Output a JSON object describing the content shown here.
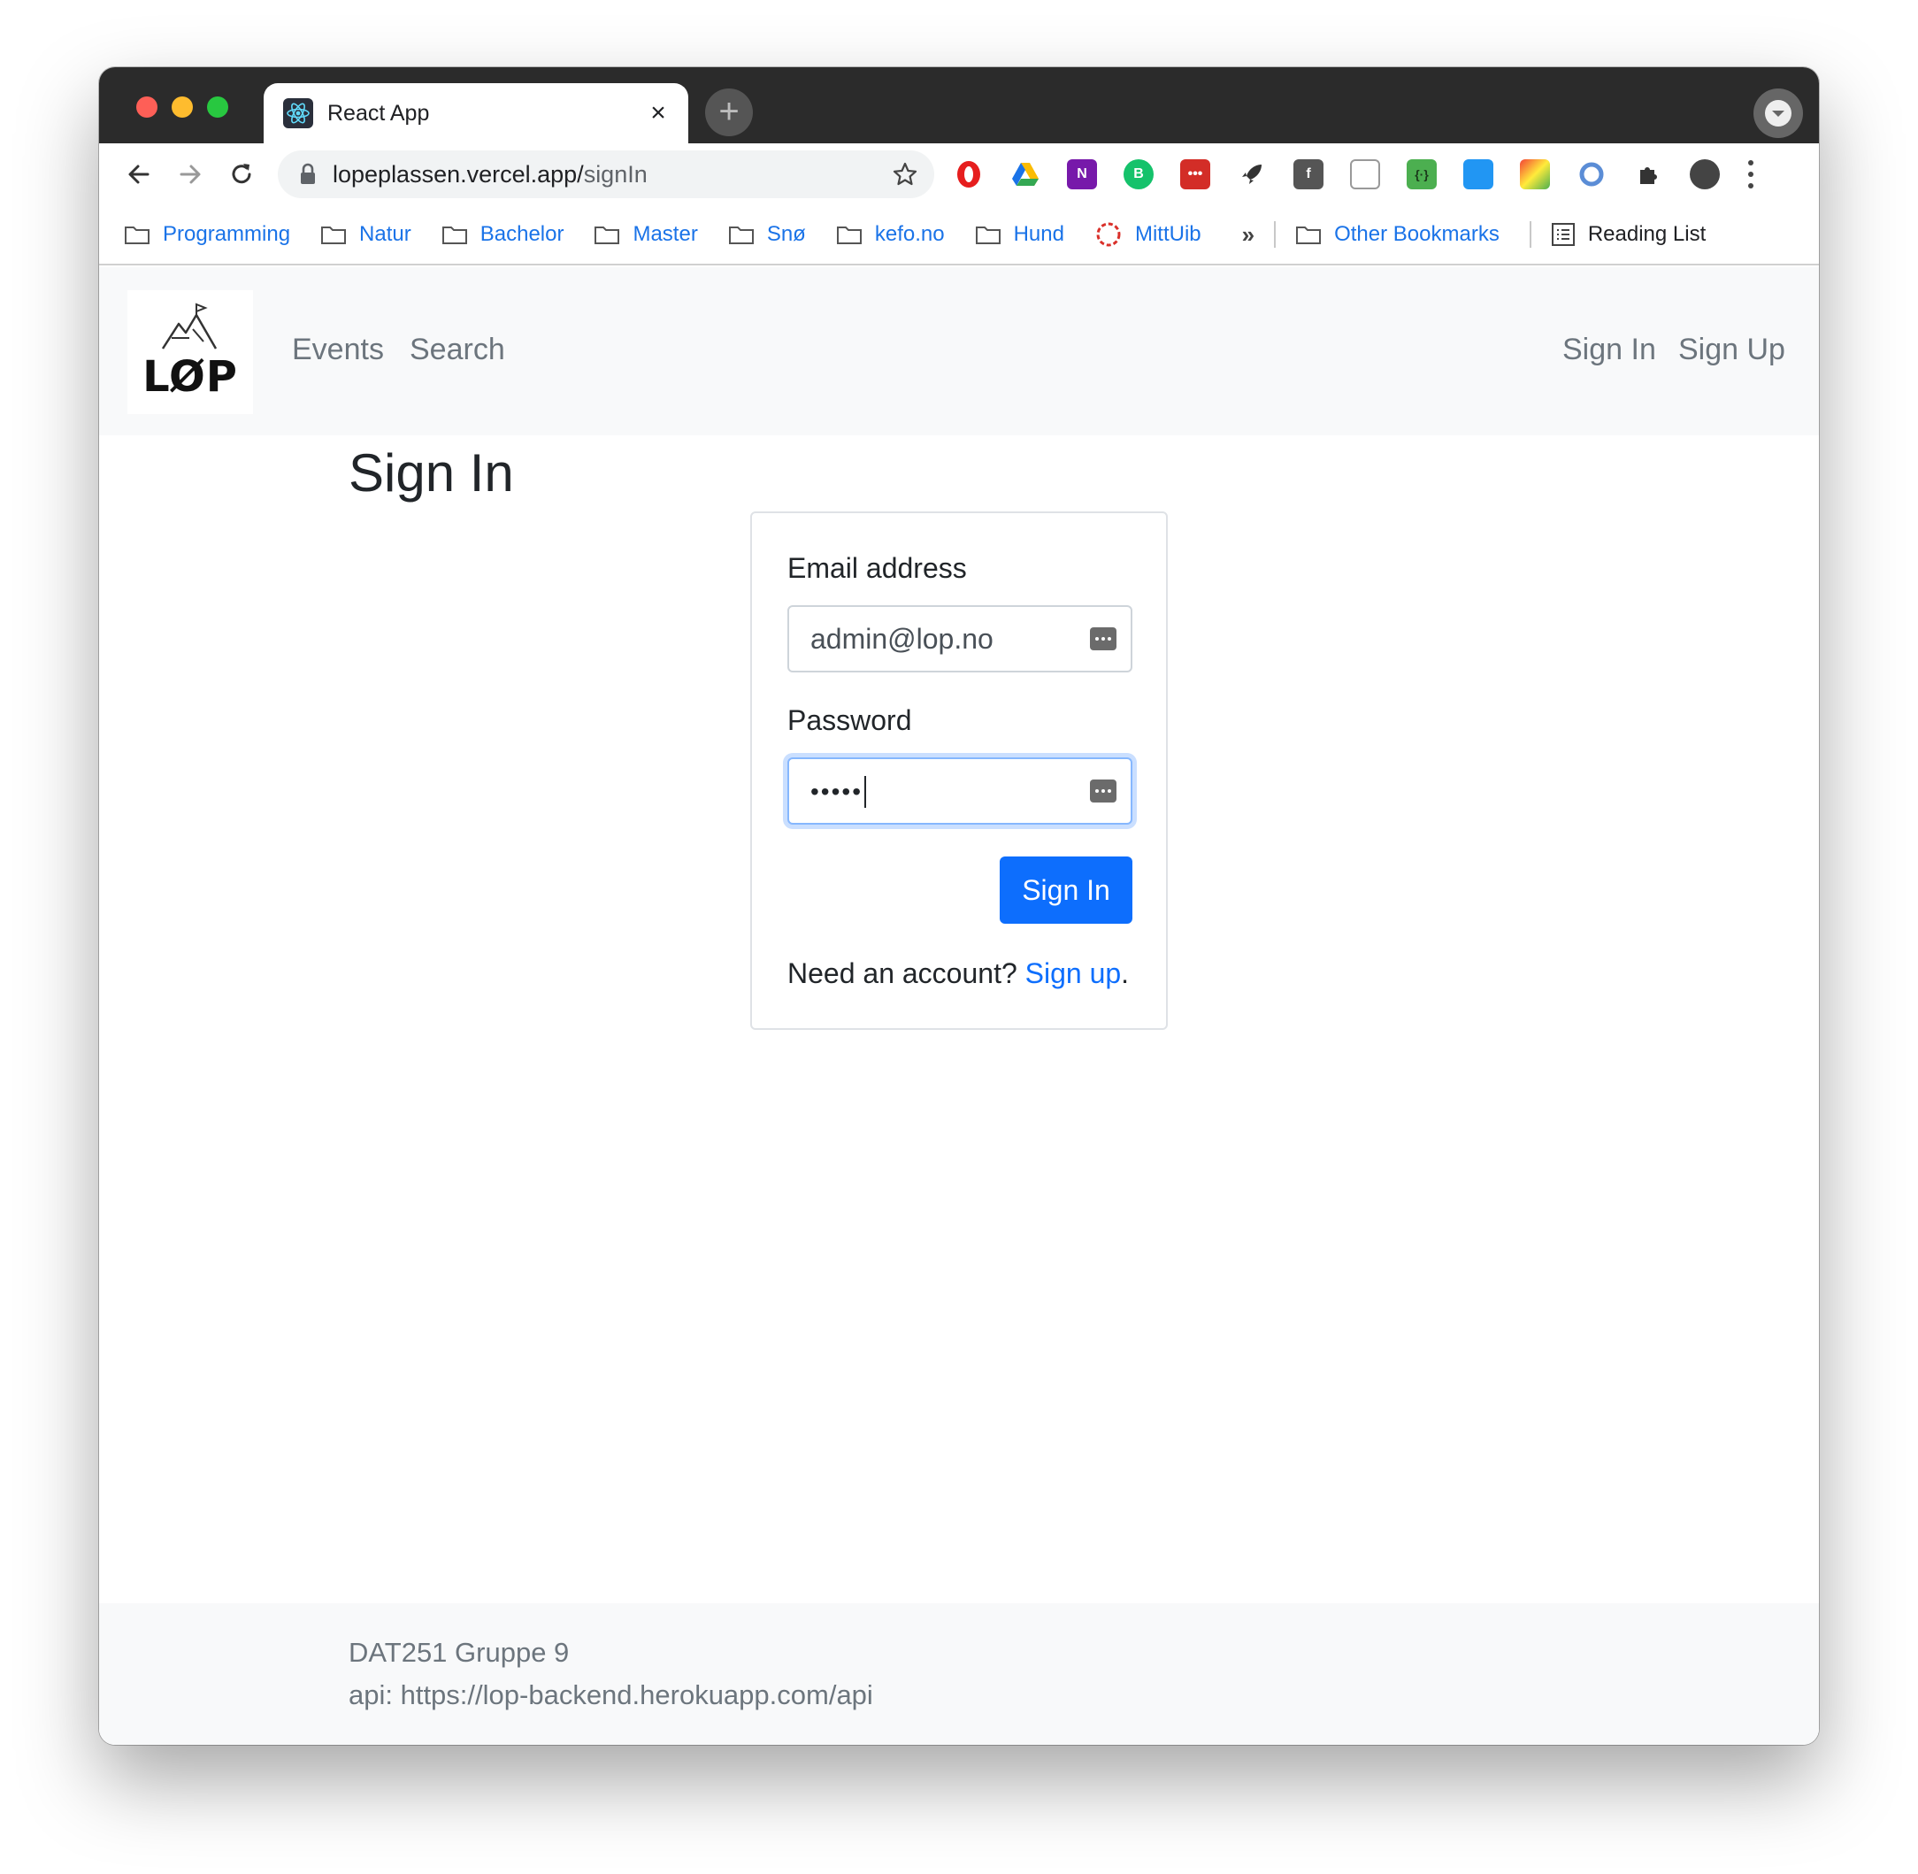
{
  "browser": {
    "tab_title": "React App",
    "tab_close": "×",
    "new_tab": "+",
    "url_host": "lopeplassen.vercel.app/",
    "url_path": "signIn",
    "bookmarks": [
      {
        "label": "Programming"
      },
      {
        "label": "Natur"
      },
      {
        "label": "Bachelor"
      },
      {
        "label": "Master"
      },
      {
        "label": "Snø"
      },
      {
        "label": "kefo.no"
      },
      {
        "label": "Hund"
      },
      {
        "label": "MittUib"
      }
    ],
    "bookmarks_more": "»",
    "other_bookmarks": "Other Bookmarks",
    "reading_list": "Reading List",
    "extensions": [
      "opera-icon",
      "google-drive-icon",
      "onenote-icon",
      "grammar-icon",
      "lastpass-icon",
      "rocket-icon",
      "facebook-icon",
      "page-icon",
      "json-icon",
      "window-icon",
      "color-picker-icon",
      "ring-icon",
      "puzzle-icon",
      "avatar-icon"
    ]
  },
  "navbar": {
    "logo_text": "LØP",
    "links": {
      "events": "Events",
      "search": "Search"
    },
    "right_links": {
      "sign_in": "Sign In",
      "sign_up": "Sign Up"
    }
  },
  "main": {
    "title": "Sign In",
    "form": {
      "email_label": "Email address",
      "email_value": "admin@lop.no",
      "password_label": "Password",
      "password_value": "•••••",
      "submit_label": "Sign In",
      "signup_prompt": "Need an account?",
      "signup_link": "Sign up",
      "signup_period": "."
    }
  },
  "footer": {
    "line1": "DAT251 Gruppe 9",
    "line2": "api: https://lop-backend.herokuapp.com/api"
  },
  "colors": {
    "primary": "#0d6efd",
    "navbar_bg": "#f8f9fa",
    "muted_text": "#6c757d"
  }
}
